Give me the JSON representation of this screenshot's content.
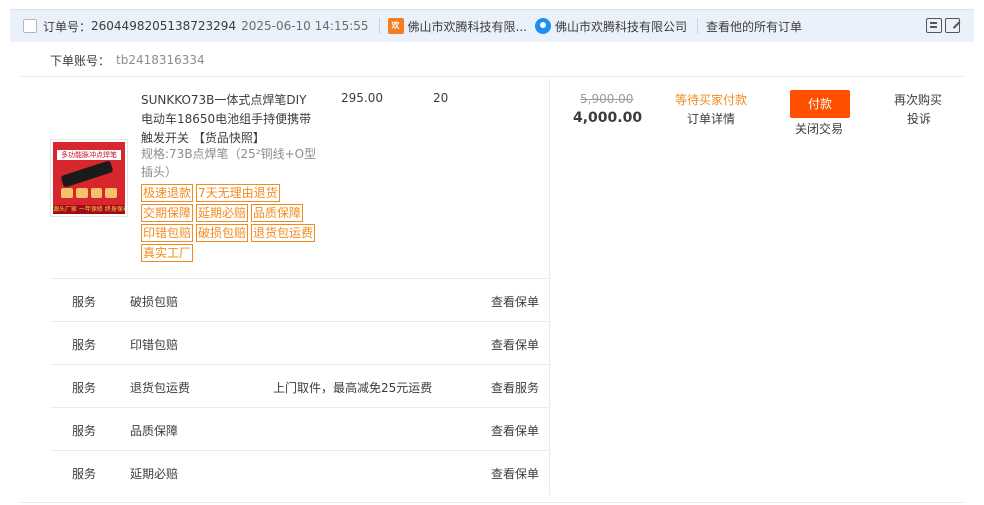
{
  "header": {
    "order_label": "订单号：",
    "order_no": "2604498205138723294",
    "order_time": "2025-06-10 14:15:55",
    "shop_logo_text": "欢",
    "shop_name": "佛山市欢腾科技有限...",
    "seller_name": "佛山市欢腾科技有限公司",
    "all_orders": "查看他的所有订单"
  },
  "account": {
    "label": "下单账号：",
    "value": "tb2418316334"
  },
  "item": {
    "thumb_title": "多功能脉冲点焊笔",
    "thumb_footer": "源头厂家 一年保修 终身保养",
    "title": "SUNKKO73B一体式点焊笔DIY电动车18650电池组手持便携带触发开关 【货品快照】",
    "spec": "规格:73B点焊笔（25²铜线+O型插头）",
    "unit_price": "295.00",
    "quantity": "20",
    "tags": [
      "极速退款",
      "7天无理由退货",
      "交期保障",
      "延期必赔",
      "品质保障",
      "印错包赔",
      "破损包赔",
      "退货包运费",
      "真实工厂"
    ]
  },
  "services": [
    {
      "label": "服务",
      "name": "破损包赔",
      "desc": "",
      "link": "查看保单"
    },
    {
      "label": "服务",
      "name": "印错包赔",
      "desc": "",
      "link": "查看保单"
    },
    {
      "label": "服务",
      "name": "退货包运费",
      "desc": "上门取件，最高减免25元运费",
      "link": "查看服务"
    },
    {
      "label": "服务",
      "name": "品质保障",
      "desc": "",
      "link": "查看保单"
    },
    {
      "label": "服务",
      "name": "延期必赔",
      "desc": "",
      "link": "查看保单"
    }
  ],
  "price": {
    "original": "5,900.00",
    "total": "4,000.00"
  },
  "status": {
    "text": "等待买家付款",
    "detail_link": "订单详情"
  },
  "actions": {
    "pay": "付款",
    "close": "关闭交易",
    "rebuy": "再次购买",
    "complain": "投诉"
  },
  "colors": {
    "accent_orange": "#ff5000",
    "status_orange": "#f28b1f",
    "header_bg": "#eaf1fb"
  },
  "icons": {
    "memo": "memo-icon",
    "edit": "edit-icon",
    "chat": "chat-icon"
  }
}
